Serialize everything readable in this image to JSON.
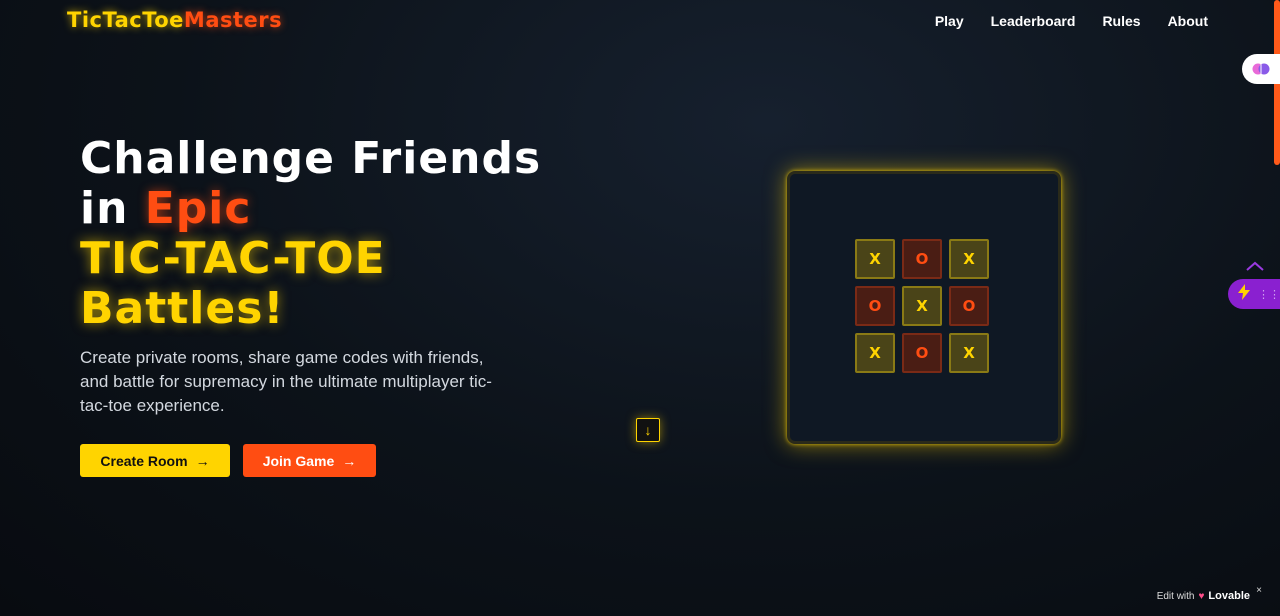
{
  "logo": {
    "part1": "TicTacToe",
    "part2": "Masters"
  },
  "nav": {
    "play": "Play",
    "leaderboard": "Leaderboard",
    "rules": "Rules",
    "about": "About"
  },
  "hero": {
    "line1": "Challenge Friends",
    "line2_pre": "in ",
    "line2_accent": "Epic",
    "line3": "TIC-TAC-TOE",
    "line4": "Battles!",
    "description": "Create private rooms, share game codes with friends, and battle for supremacy in the ultimate multiplayer tic-tac-toe experience."
  },
  "buttons": {
    "create": "Create Room",
    "join": "Join Game",
    "arrow": "→"
  },
  "scroll_indicator": "↓",
  "board": {
    "cells": [
      "X",
      "O",
      "X",
      "O",
      "X",
      "O",
      "X",
      "O",
      "X"
    ],
    "colors": {
      "x": "#ffd400",
      "o": "#ff4d12"
    }
  },
  "widgets": {
    "edit_with": "Edit with",
    "lovable": "Lovable",
    "close": "×"
  },
  "colors": {
    "accent_yellow": "#ffd400",
    "accent_orange": "#ff4d12",
    "widget_purple": "#8a20d0"
  }
}
